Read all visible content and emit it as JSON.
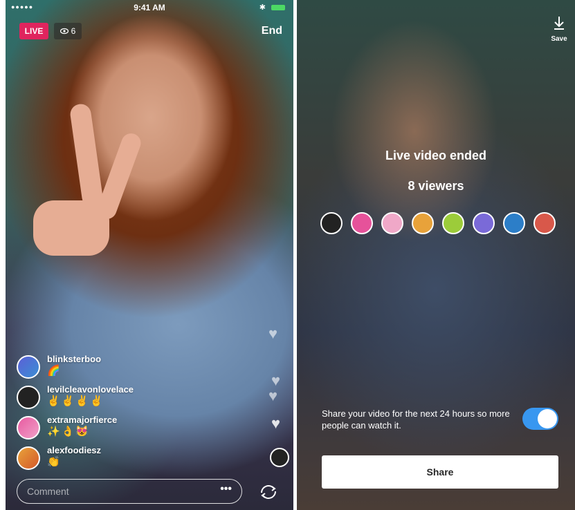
{
  "left_screen": {
    "status_bar": {
      "time": "9:41 AM"
    },
    "live_badge": "LIVE",
    "viewer_count": "6",
    "end_label": "End",
    "comments": [
      {
        "username": "blinksterboo",
        "text": "🌈"
      },
      {
        "username": "levilcleavonlovelace",
        "text": "✌✌✌✌"
      },
      {
        "username": "extramajorfierce",
        "text": "✨👌😻"
      },
      {
        "username": "alexfoodiesz",
        "text": "👏"
      }
    ],
    "comment_input": {
      "placeholder": "Comment",
      "more_label": "•••"
    }
  },
  "right_screen": {
    "save_label": "Save",
    "ended_title": "Live video ended",
    "viewers_label": "8 viewers",
    "viewer_avatar_colors": [
      "#222222",
      "#e6529a",
      "#f0a8c8",
      "#e8a23a",
      "#9ccc3a",
      "#7a6ad8",
      "#2c7ec8",
      "#d8584a"
    ],
    "share_prompt": "Share your video for the next 24 hours so more people can watch it.",
    "share_toggle_on": true,
    "share_button": "Share"
  },
  "colors": {
    "live": "#e0245e",
    "toggle": "#3897f0"
  },
  "icons": [
    "eye-icon",
    "download-icon",
    "switch-camera-icon",
    "heart-icon",
    "battery-icon"
  ]
}
